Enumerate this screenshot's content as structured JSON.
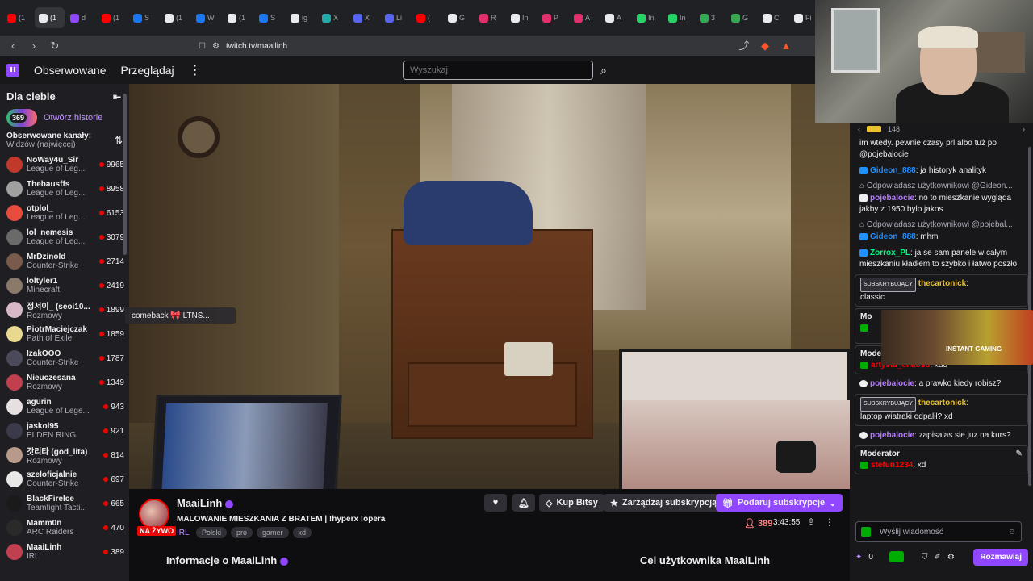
{
  "browser": {
    "tabs": [
      {
        "label": "(1",
        "color": "#ff0000"
      },
      {
        "label": "(1",
        "color": "#e8eaed",
        "active": true
      },
      {
        "label": "d",
        "color": "#9146ff"
      },
      {
        "label": "(1",
        "color": "#ff0000"
      },
      {
        "label": "S",
        "color": "#1877f2"
      },
      {
        "label": "(1",
        "color": "#e8eaed"
      },
      {
        "label": "W",
        "color": "#1877f2"
      },
      {
        "label": "(1",
        "color": "#e8eaed"
      },
      {
        "label": "S",
        "color": "#1877f2"
      },
      {
        "label": "ig",
        "color": "#e8eaed"
      },
      {
        "label": "X",
        "color": "#2aa"
      },
      {
        "label": "X",
        "color": "#5865f2"
      },
      {
        "label": "Li",
        "color": "#5865f2"
      },
      {
        "label": "(",
        "color": "#ff0000"
      },
      {
        "label": "G",
        "color": "#e8eaed"
      },
      {
        "label": "R",
        "color": "#e1306c"
      },
      {
        "label": "In",
        "color": "#e8eaed"
      },
      {
        "label": "P",
        "color": "#e1306c"
      },
      {
        "label": "A",
        "color": "#e1306c"
      },
      {
        "label": "A",
        "color": "#e8eaed"
      },
      {
        "label": "In",
        "color": "#25d366"
      },
      {
        "label": "In",
        "color": "#25d366"
      },
      {
        "label": "3",
        "color": "#34a853"
      },
      {
        "label": "G",
        "color": "#34a853"
      },
      {
        "label": "C",
        "color": "#e8eaed"
      },
      {
        "label": "Fi",
        "color": "#e8eaed"
      }
    ],
    "url": "twitch.tv/maailinh"
  },
  "topnav": {
    "following": "Obserwowane",
    "browse": "Przeglądaj",
    "search_placeholder": "Wyszukaj"
  },
  "sidebar": {
    "for_you": "Dla ciebie",
    "story_count": "369",
    "story_label": "Otwórz historie",
    "rec_title": "Obserwowane kanały:",
    "rec_sort": "Widzów (najwięcej)",
    "channels": [
      {
        "name": "NoWay4u_Sir",
        "game": "League of Leg...",
        "viewers": "9965",
        "color": "#c0392b"
      },
      {
        "name": "Thebausffs",
        "game": "League of Leg...",
        "viewers": "8958",
        "color": "#a0a0a0"
      },
      {
        "name": "otplol_",
        "game": "League of Leg...",
        "viewers": "6153",
        "color": "#e74c3c"
      },
      {
        "name": "lol_nemesis",
        "game": "League of Leg...",
        "viewers": "3079",
        "color": "#6a6a6a"
      },
      {
        "name": "MrDzinold",
        "game": "Counter-Strike",
        "viewers": "2714",
        "color": "#7a5a4a"
      },
      {
        "name": "loltyler1",
        "game": "Minecraft",
        "viewers": "2419",
        "color": "#8a7a6a"
      },
      {
        "name": "정서이_ (seoi10...",
        "game": "Rozmowy",
        "viewers": "1899",
        "color": "#d8b8c8"
      },
      {
        "name": "PiotrMaciejczak",
        "game": "Path of Exile",
        "viewers": "1859",
        "color": "#e8d890"
      },
      {
        "name": "IzakOOO",
        "game": "Counter-Strike",
        "viewers": "1787",
        "color": "#4a4a5a"
      },
      {
        "name": "Nieuczesana",
        "game": "Rozmowy",
        "viewers": "1349",
        "color": "#c04050"
      },
      {
        "name": "agurin",
        "game": "League of Lege...",
        "viewers": "943",
        "color": "#e8e0e0"
      },
      {
        "name": "jaskol95",
        "game": "ELDEN RING",
        "viewers": "921",
        "color": "#3a3a4a"
      },
      {
        "name": "갓리타 (god_lita)",
        "game": "Rozmowy",
        "viewers": "814",
        "color": "#b89a8a"
      },
      {
        "name": "szeloficjalnie",
        "game": "Counter-Strike",
        "viewers": "697",
        "color": "#e8e8e8"
      },
      {
        "name": "BlackFireIce",
        "game": "Teamfight Tacti...",
        "viewers": "665",
        "color": "#1a1a1a"
      },
      {
        "name": "Mamm0n",
        "game": "ARC Raiders",
        "viewers": "470",
        "color": "#2a2a2a"
      },
      {
        "name": "MaaiLinh",
        "game": "IRL",
        "viewers": "389",
        "color": "#c04050"
      }
    ]
  },
  "video": {
    "overlay_chip": "comeback 🎀 LTNS..."
  },
  "stream": {
    "streamer": "MaaiLinh",
    "live": "NA ŻYWO",
    "title": "MALOWANIE MIESZKANIA Z BRATEM | !hyperx !opera",
    "category": "IRL",
    "tags": [
      "Polski",
      "pro",
      "gamer",
      "xd"
    ],
    "bits": "Kup Bitsy",
    "manage_sub": "Zarządzaj subskrypcją",
    "gift_sub": "Podaruj subskrypcje",
    "viewers": "389",
    "uptime": "3:43:55",
    "about": "Informacje o MaaiLinh",
    "goal": "Cel użytkownika MaaiLinh"
  },
  "chat": {
    "top_count": "148",
    "intro": "im wtedy. pewnie czasy prl albo tuż po @pojebalocie",
    "messages": [
      {
        "type": "msg",
        "user": "Gideon_888",
        "color": "#1e90ff",
        "text": ": ja historyk analityk",
        "badge": "#1e90ff"
      },
      {
        "type": "reply",
        "text": "Odpowiadasz użytkownikowi @Gideon..."
      },
      {
        "type": "msg",
        "user": "pojebalocie",
        "color": "#b57aff",
        "text": ": no to mieszkanie wygląda jakby z 1950 bylo jakos",
        "badge": "#efeff1"
      },
      {
        "type": "reply",
        "text": "Odpowiadasz użytkownikowi @pojebal..."
      },
      {
        "type": "msg",
        "user": "Gideon_888",
        "color": "#1e90ff",
        "text": ": mhm",
        "badge": "#1e90ff"
      },
      {
        "type": "msg",
        "user": "Zorrox_PL",
        "color": "#00ff7f",
        "text": ": ja se sam panele w całym mieszkaniu kładłem to szybko i łatwo poszło",
        "badge": "#1e90ff"
      }
    ],
    "card1": {
      "badge": "SUBSKRYBUJĄCY",
      "user": "thecartonick",
      "text": "classic"
    },
    "card2": {
      "header": "Mo",
      "icon": "#00ad03"
    },
    "card3": {
      "header": "Moderator",
      "user": "artysta_chaosu",
      "text": ": xdd"
    },
    "msg_mid": {
      "user": "pojebalocie",
      "text": ": a prawko kiedy robisz?"
    },
    "card4": {
      "badge": "SUBSKRYBUJĄCY",
      "user": "thecartonick",
      "text": "laptop wiatraki odpalił? xd"
    },
    "msg_mid2": {
      "user": "pojebalocie",
      "text": ": zapisalas sie juz na kurs?"
    },
    "card5": {
      "header": "Moderator",
      "user": "stefun1234",
      "text": ": xd"
    },
    "input_placeholder": "Wyślij wiadomość",
    "points": "0",
    "send": "Rozmawiaj",
    "ad_text": "INSTANT GAMING"
  }
}
